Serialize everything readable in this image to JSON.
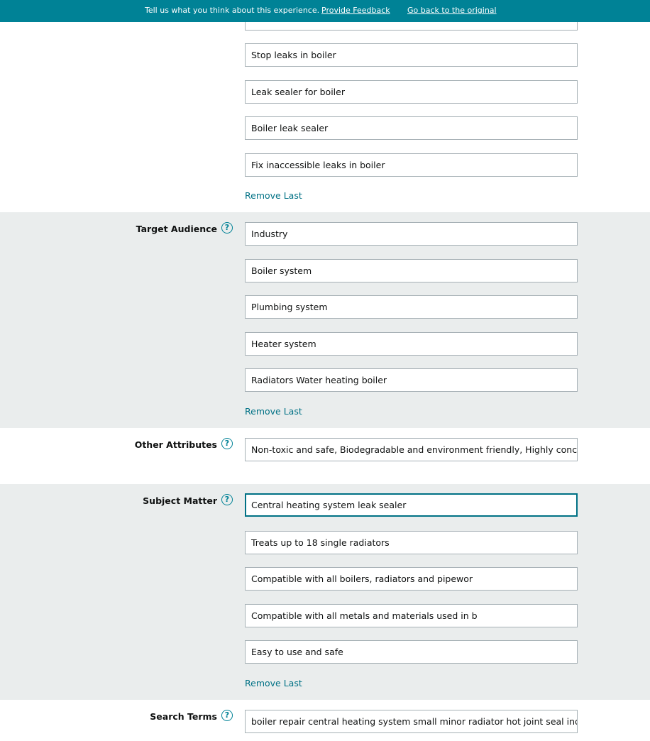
{
  "banner": {
    "message": "Tell us what you think about this experience.",
    "feedback_link": "Provide Feedback",
    "original_link": "Go back to the original"
  },
  "intended_use": {
    "values": [
      "Stop leaks in boiler",
      "Leak sealer for boiler",
      "Boiler leak sealer",
      "Fix inaccessible leaks in boiler"
    ],
    "remove_label": "Remove Last"
  },
  "target_audience": {
    "label": "Target Audience",
    "help_icon": "?",
    "values": [
      "Industry",
      "Boiler system",
      "Plumbing system",
      "Heater system",
      "Radiators Water heating boiler"
    ],
    "remove_label": "Remove Last"
  },
  "other_attributes": {
    "label": "Other Attributes",
    "help_icon": "?",
    "value": "Non-toxic and safe, Biodegradable and environment friendly, Highly conc…"
  },
  "subject_matter": {
    "label": "Subject Matter",
    "help_icon": "?",
    "values": [
      "Central heating system leak sealer",
      "Treats up to 18 single radiators",
      "Compatible with all boilers, radiators and pipewor",
      "Compatible with all metals and materials used in b",
      "Easy to use and safe"
    ],
    "remove_label": "Remove Last"
  },
  "search_terms": {
    "label": "Search Terms",
    "help_icon": "?",
    "value": "boiler repair central heating system small minor radiator hot joint seal indus"
  }
}
